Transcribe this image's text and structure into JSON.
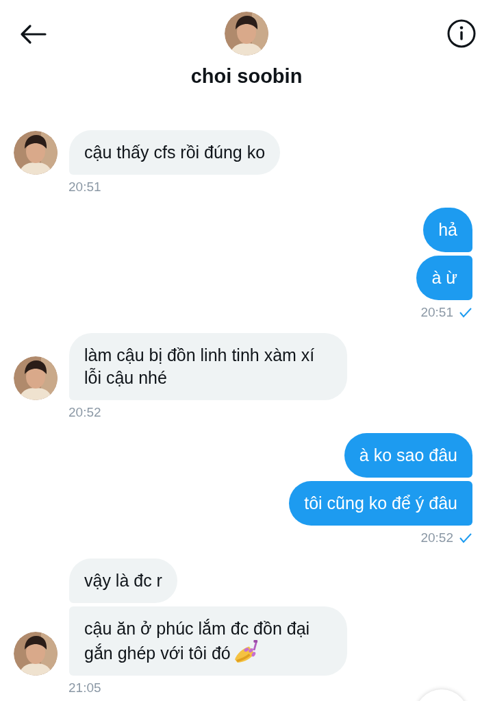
{
  "header": {
    "name": "choi soobin"
  },
  "groups": [
    {
      "kind": "received",
      "bubbles": [
        {
          "kind": "text",
          "text": "cậu thấy cfs rồi đúng ko"
        }
      ],
      "time": "20:51",
      "read": false
    },
    {
      "kind": "sent",
      "bubbles": [
        {
          "kind": "text",
          "text": "hả"
        },
        {
          "kind": "text",
          "text": "à ừ"
        }
      ],
      "time": "20:51",
      "read": true
    },
    {
      "kind": "received",
      "bubbles": [
        {
          "kind": "text",
          "text": "làm cậu bị đồn linh tinh xàm xí lỗi cậu nhé"
        }
      ],
      "time": "20:52",
      "read": false
    },
    {
      "kind": "sent",
      "bubbles": [
        {
          "kind": "text",
          "text": "à ko sao đâu"
        },
        {
          "kind": "text",
          "text": "tôi cũng ko để ý đâu"
        }
      ],
      "time": "20:52",
      "read": true
    },
    {
      "kind": "received",
      "bubbles": [
        {
          "kind": "text",
          "text": "vậy là đc r"
        },
        {
          "kind": "text_with_emoji",
          "text": "cậu ăn ở phúc lắm đc đồn đại gắn ghép với tôi đó"
        }
      ],
      "time": "21:05",
      "read": false
    }
  ]
}
